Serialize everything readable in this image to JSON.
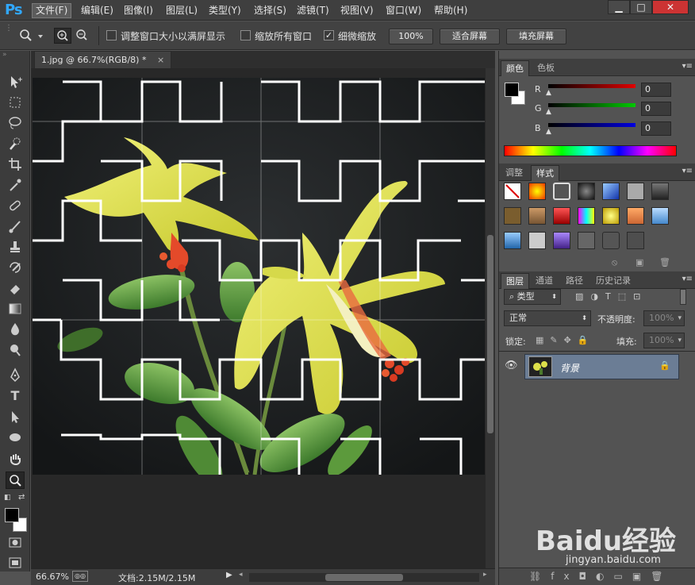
{
  "app": {
    "logo": "Ps"
  },
  "menu": [
    "文件(F)",
    "编辑(E)",
    "图像(I)",
    "图层(L)",
    "类型(Y)",
    "选择(S)",
    "滤镜(T)",
    "视图(V)",
    "窗口(W)",
    "帮助(H)"
  ],
  "window_controls": {
    "minimize": "▁",
    "maximize": "□",
    "close": "✕"
  },
  "options": {
    "resize_windows_label": "调整窗口大小以满屏显示",
    "zoom_all_label": "缩放所有窗口",
    "scrubby_zoom_label": "细微缩放",
    "btn_100": "100%",
    "btn_fit": "适合屏幕",
    "btn_fill": "填充屏幕"
  },
  "document": {
    "tab_title": "1.jpg @ 66.7%(RGB/8) *",
    "close_glyph": "×",
    "zoom": "66.67%",
    "doc_size": "文档:2.15M/2.15M"
  },
  "color_panel": {
    "tabs": [
      "颜色",
      "色板"
    ],
    "channels": [
      {
        "name": "R",
        "value": "0"
      },
      {
        "name": "G",
        "value": "0"
      },
      {
        "name": "B",
        "value": "0"
      }
    ],
    "colors": {
      "r": "#e00000",
      "g": "#00c800",
      "b": "#0000e0"
    }
  },
  "adjust_panel": {
    "tabs": [
      "调整",
      "样式"
    ]
  },
  "layers_panel": {
    "tabs": [
      "图层",
      "通道",
      "路径",
      "历史记录"
    ],
    "filter_label": "类型",
    "blend_mode": "正常",
    "opacity_label": "不透明度:",
    "opacity_value": "100%",
    "lock_label": "锁定:",
    "fill_label": "填充:",
    "fill_value": "100%",
    "layers": [
      {
        "name": "背景",
        "locked": true,
        "visible": true
      }
    ]
  },
  "watermark": {
    "brand": "Baidu经验",
    "url": "jingyan.baidu.com"
  }
}
